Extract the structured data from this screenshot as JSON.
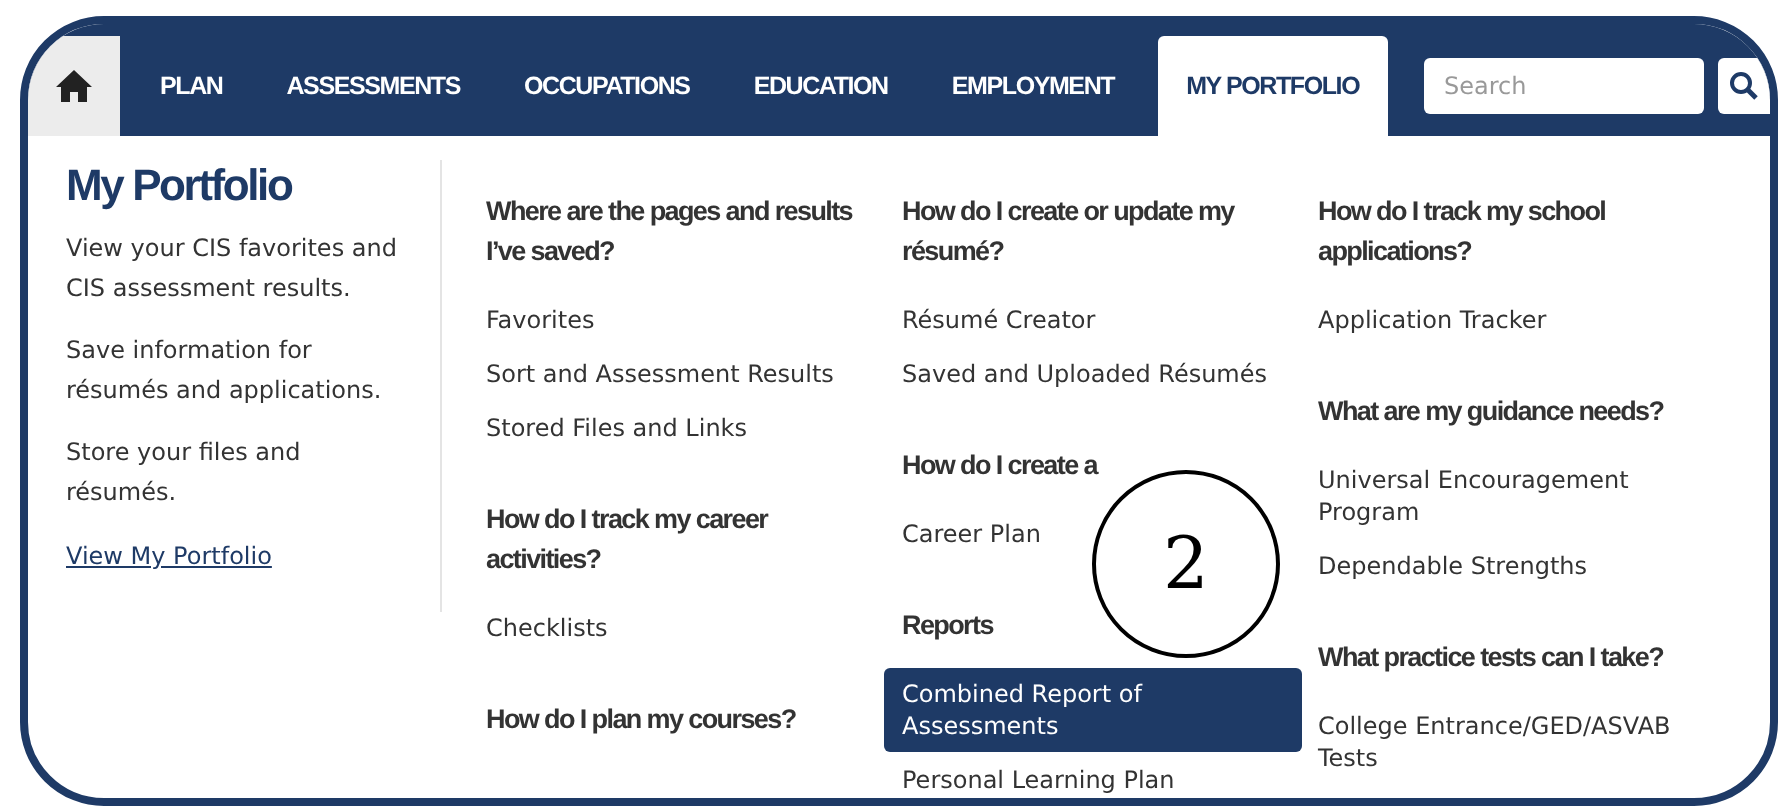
{
  "nav": {
    "tabs": [
      {
        "kind": "home",
        "selected": false
      },
      {
        "kind": "text",
        "label": "PLAN",
        "selected": false
      },
      {
        "kind": "text",
        "label": "ASSESSMENTS",
        "selected": false
      },
      {
        "kind": "text",
        "label": "OCCUPATIONS",
        "selected": false
      },
      {
        "kind": "text",
        "label": "EDUCATION",
        "selected": false
      },
      {
        "kind": "text",
        "label": "EMPLOYMENT",
        "selected": false
      },
      {
        "kind": "text",
        "label": "MY PORTFOLIO",
        "selected": true
      }
    ],
    "search": {
      "placeholder": "Search"
    }
  },
  "menu": {
    "intro": {
      "title": "My Portfolio",
      "paragraphs": [
        "View your CIS favorites and CIS assessment results.",
        "Save information for résumés and applications.",
        "Store your files and résumés."
      ],
      "link": "View My Portfolio"
    },
    "columns": [
      {
        "sections": [
          {
            "heading": "Where are the pages and results I’ve saved?",
            "items": [
              {
                "label": "Favorites",
                "selected": false
              },
              {
                "label": "Sort and Assessment Results",
                "selected": false
              },
              {
                "label": "Stored Files and Links",
                "selected": false
              }
            ]
          },
          {
            "heading": "How do I track my career activities?",
            "items": [
              {
                "label": "Checklists",
                "selected": false
              }
            ]
          },
          {
            "heading": "How do I plan my courses?"
          }
        ]
      },
      {
        "sections": [
          {
            "heading": "How do I create or update my résumé?",
            "items": [
              {
                "label": "Résumé Creator",
                "selected": false
              },
              {
                "label": "Saved and Uploaded Résumés",
                "selected": false
              }
            ]
          },
          {
            "heading": "How do I create a",
            "items": [
              {
                "label": "Career Plan",
                "selected": false
              }
            ]
          },
          {
            "heading": "Reports",
            "items": [
              {
                "label": "Combined Report of Assessments",
                "selected": true
              },
              {
                "label": "Personal Learning Plan",
                "selected": false
              }
            ]
          }
        ]
      },
      {
        "sections": [
          {
            "heading": "How do I track my school applications?",
            "items": [
              {
                "label": "Application Tracker",
                "selected": false
              }
            ]
          },
          {
            "heading": "What are my guidance needs?",
            "items": [
              {
                "label": "Universal Encouragement Program",
                "selected": false
              },
              {
                "label": "Dependable Strengths",
                "selected": false
              }
            ]
          },
          {
            "heading": "What practice tests can I take?",
            "items": [
              {
                "label": "College Entrance/GED/ASVAB Tests",
                "selected": false
              }
            ]
          }
        ]
      }
    ]
  },
  "callout": {
    "label": "2"
  }
}
